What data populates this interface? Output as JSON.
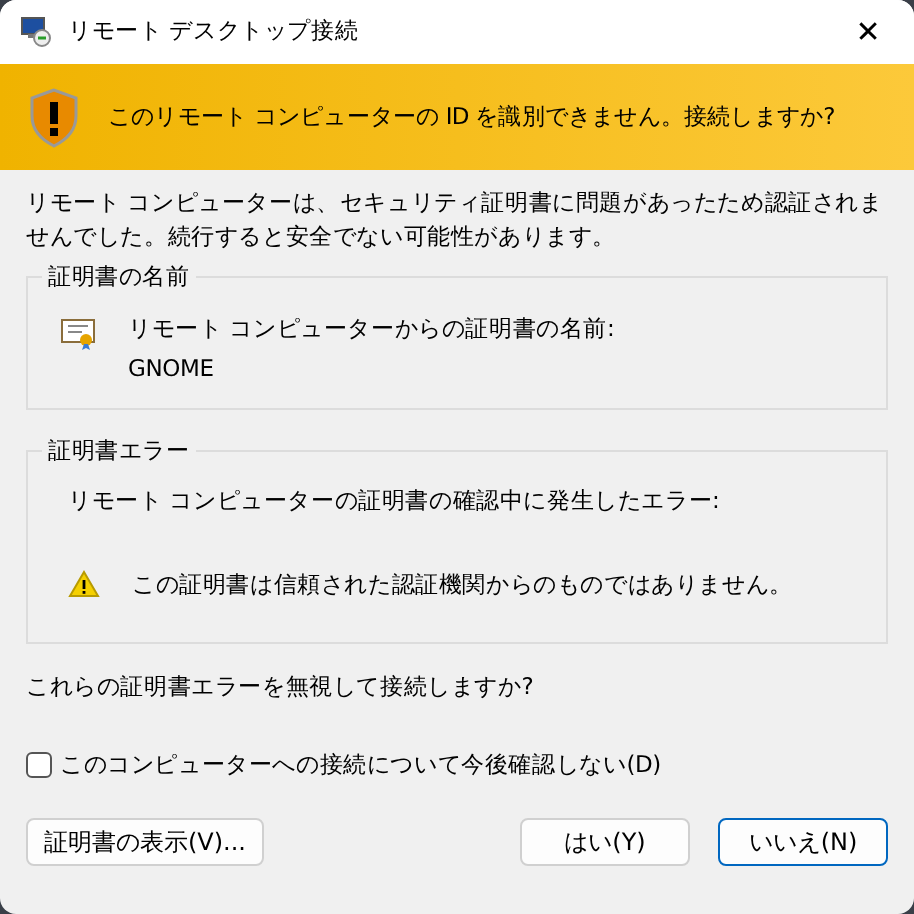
{
  "window": {
    "title": "リモート デスクトップ接続",
    "close": "✕"
  },
  "banner": {
    "text": "このリモート コンピューターの ID を識別できません。接続しますか?"
  },
  "message": "リモート コンピューターは、セキュリティ証明書に問題があったため認証されませんでした。続行すると安全でない可能性があります。",
  "certificate_name": {
    "legend": "証明書の名前",
    "label": "リモート コンピューターからの証明書の名前:",
    "value": "GNOME"
  },
  "certificate_errors": {
    "legend": "証明書エラー",
    "intro": "リモート コンピューターの証明書の確認中に発生したエラー:",
    "errors": [
      "この証明書は信頼された認証機関からのものではありません。"
    ]
  },
  "question": "これらの証明書エラーを無視して接続しますか?",
  "checkbox": {
    "label": "このコンピューターへの接続について今後確認しない(D)",
    "checked": false
  },
  "buttons": [
    {
      "label": "証明書の表示(V)...",
      "default": false,
      "kind": "left"
    },
    {
      "label": "はい(Y)",
      "default": false,
      "kind": "right"
    },
    {
      "label": "いいえ(N)",
      "default": true,
      "kind": "right"
    }
  ]
}
